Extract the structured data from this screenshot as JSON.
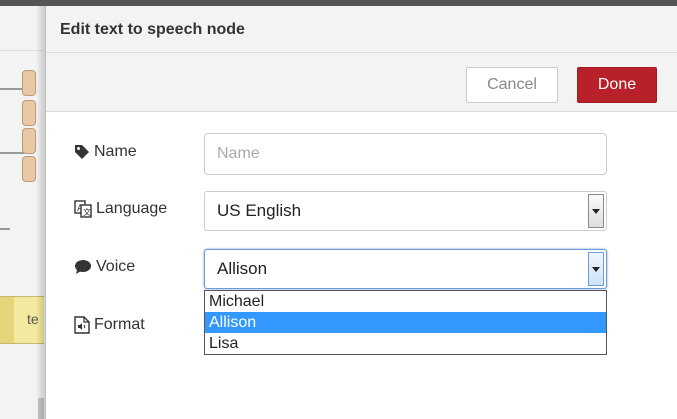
{
  "workspace": {
    "node_label": "te"
  },
  "editor": {
    "title": "Edit text to speech node",
    "cancel_label": "Cancel",
    "done_label": "Done"
  },
  "form": {
    "name": {
      "label": "Name",
      "placeholder": "Name",
      "value": "",
      "icon": "tag-icon"
    },
    "language": {
      "label": "Language",
      "value": "US English",
      "icon": "language-icon"
    },
    "voice": {
      "label": "Voice",
      "value": "Allison",
      "icon": "speech-bubble-icon",
      "options": [
        "Michael",
        "Allison",
        "Lisa"
      ],
      "selected_index": 1
    },
    "format": {
      "label": "Format",
      "icon": "audio-file-icon"
    }
  },
  "colors": {
    "done_button": "#b8212a",
    "dropdown_highlight": "#3399ff",
    "focus_border": "#6d9cd6"
  }
}
